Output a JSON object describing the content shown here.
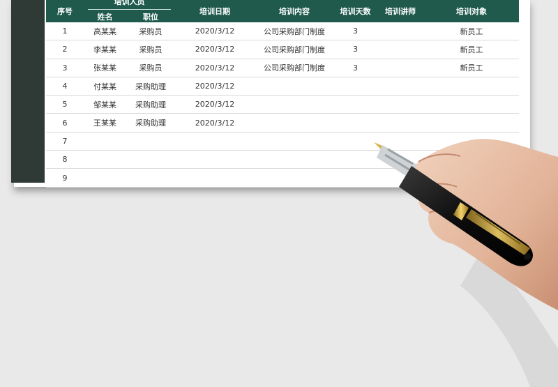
{
  "headers": {
    "seq": "序号",
    "trainee_group": "培训人员",
    "name": "姓名",
    "position": "职位",
    "date": "培训日期",
    "content": "培训内容",
    "days": "培训天数",
    "lecturer": "培训讲师",
    "target": "培训对象"
  },
  "rows": [
    {
      "seq": "1",
      "name": "高某某",
      "position": "采购员",
      "date": "2020/3/12",
      "content": "公司采购部门制度",
      "days": "3",
      "lecturer": "",
      "target": "新员工"
    },
    {
      "seq": "2",
      "name": "李某某",
      "position": "采购员",
      "date": "2020/3/12",
      "content": "公司采购部门制度",
      "days": "3",
      "lecturer": "",
      "target": "新员工"
    },
    {
      "seq": "3",
      "name": "张某某",
      "position": "采购员",
      "date": "2020/3/12",
      "content": "公司采购部门制度",
      "days": "3",
      "lecturer": "",
      "target": "新员工"
    },
    {
      "seq": "4",
      "name": "付某某",
      "position": "采购助理",
      "date": "2020/3/12",
      "content": "",
      "days": "",
      "lecturer": "",
      "target": ""
    },
    {
      "seq": "5",
      "name": "邹某某",
      "position": "采购助理",
      "date": "2020/3/12",
      "content": "",
      "days": "",
      "lecturer": "",
      "target": ""
    },
    {
      "seq": "6",
      "name": "王某某",
      "position": "采购助理",
      "date": "2020/3/12",
      "content": "",
      "days": "",
      "lecturer": "",
      "target": ""
    },
    {
      "seq": "7",
      "name": "",
      "position": "",
      "date": "",
      "content": "",
      "days": "",
      "lecturer": "",
      "target": ""
    },
    {
      "seq": "8",
      "name": "",
      "position": "",
      "date": "",
      "content": "",
      "days": "",
      "lecturer": "",
      "target": ""
    },
    {
      "seq": "9",
      "name": "",
      "position": "",
      "date": "",
      "content": "",
      "days": "",
      "lecturer": "",
      "target": ""
    }
  ],
  "colors": {
    "header_bg": "#1f5a4d",
    "sidebar_bg": "#2f3a36",
    "page_bg": "#e9e9e9"
  }
}
